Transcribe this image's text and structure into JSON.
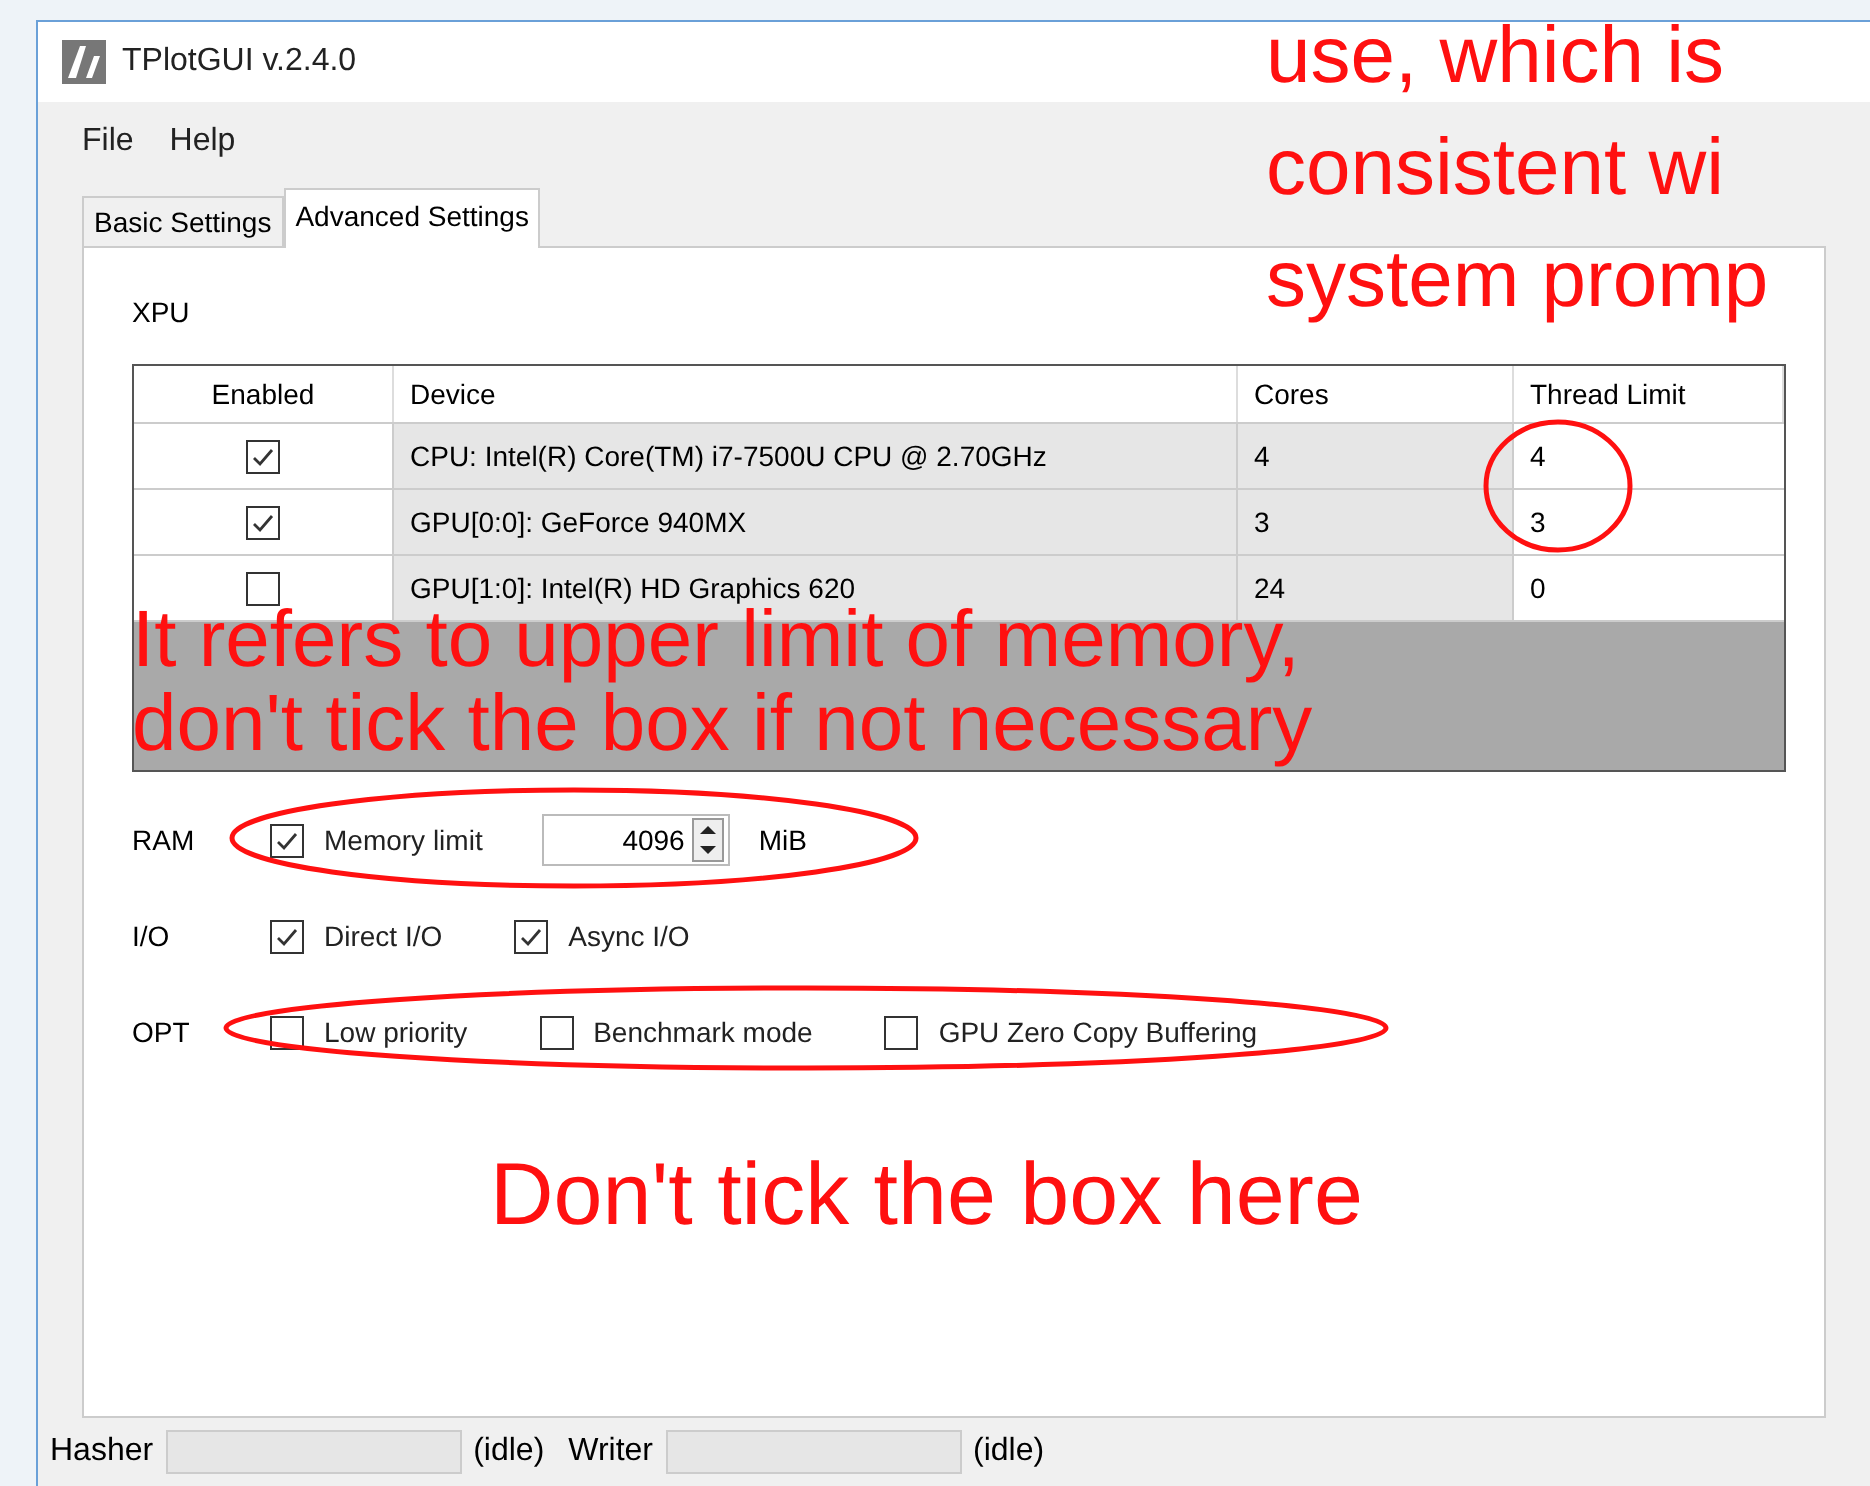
{
  "window": {
    "title": "TPlotGUI v.2.4.0"
  },
  "menu": [
    "File",
    "Help"
  ],
  "tabs": [
    {
      "label": "Basic Settings",
      "selected": false
    },
    {
      "label": "Advanced Settings",
      "selected": true
    }
  ],
  "xpu": {
    "label": "XPU",
    "columns": [
      "Enabled",
      "Device",
      "Cores",
      "Thread Limit"
    ],
    "rows": [
      {
        "checked": true,
        "device": "CPU: Intel(R) Core(TM) i7-7500U CPU @ 2.70GHz",
        "cores": "4",
        "thread_limit": "4"
      },
      {
        "checked": true,
        "device": "GPU[0:0]: GeForce 940MX",
        "cores": "3",
        "thread_limit": "3"
      },
      {
        "checked": false,
        "device": "GPU[1:0]: Intel(R) HD Graphics 620",
        "cores": "24",
        "thread_limit": "0"
      }
    ]
  },
  "ram": {
    "label": "RAM",
    "option": {
      "label": "Memory limit",
      "checked": true
    },
    "value": "4096",
    "unit": "MiB"
  },
  "io": {
    "label": "I/O",
    "options": [
      {
        "label": "Direct I/O",
        "checked": true
      },
      {
        "label": "Async I/O",
        "checked": true
      }
    ]
  },
  "opt": {
    "label": "OPT",
    "options": [
      {
        "label": "Low priority",
        "checked": false
      },
      {
        "label": "Benchmark mode",
        "checked": false
      },
      {
        "label": "GPU Zero Copy Buffering",
        "checked": false
      }
    ]
  },
  "status_bar": [
    {
      "label": "Hasher",
      "status": "(idle)"
    },
    {
      "label": "Writer",
      "status": "(idle)"
    }
  ],
  "annotations": [
    "use, which is\nconsistent wi\nsystem promp",
    "It refers to upper limit of memory,\ndon't tick the box if not necessary",
    "Don't tick the box here"
  ]
}
